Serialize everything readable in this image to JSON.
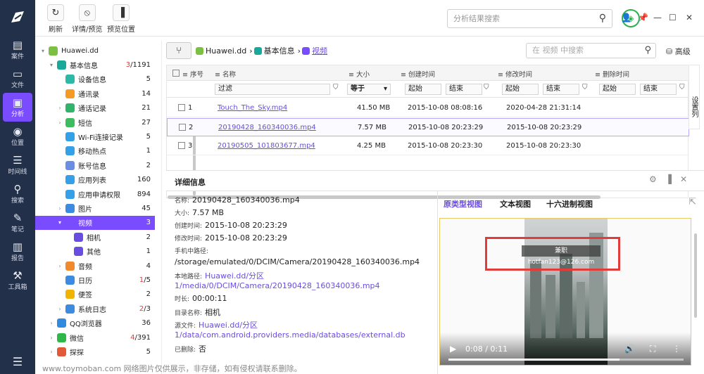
{
  "rail": [
    {
      "label": "案件",
      "icon": "case-icon"
    },
    {
      "label": "文件",
      "icon": "folder-icon"
    },
    {
      "label": "分析",
      "icon": "analysis-icon",
      "active": true
    },
    {
      "label": "位置",
      "icon": "location-icon"
    },
    {
      "label": "时间线",
      "icon": "timeline-icon"
    },
    {
      "label": "搜索",
      "icon": "search-icon"
    },
    {
      "label": "笔记",
      "icon": "note-icon"
    },
    {
      "label": "报告",
      "icon": "report-icon"
    },
    {
      "label": "工具箱",
      "icon": "toolbox-icon"
    }
  ],
  "toolbar": {
    "refresh": "刷新",
    "details": "详情/预览",
    "preview_pos": "预览位置",
    "global_search_placeholder": "分析结果搜索"
  },
  "tree": [
    {
      "label": "Huawei.dd",
      "indent": 0,
      "arrow": "▾",
      "color": "#7bc043"
    },
    {
      "label": "基本信息",
      "indent": 1,
      "arrow": "▾",
      "color": "#18a99b",
      "cnt_red": "3",
      "cnt": "/1191"
    },
    {
      "label": "设备信息",
      "indent": 2,
      "color": "#2db7a6",
      "cnt": "5"
    },
    {
      "label": "通讯录",
      "indent": 2,
      "color": "#f59a23",
      "cnt": "14"
    },
    {
      "label": "通话记录",
      "indent": 2,
      "arrow": "›",
      "color": "#31b36b",
      "cnt": "21"
    },
    {
      "label": "短信",
      "indent": 2,
      "arrow": "›",
      "color": "#3dbb5e",
      "cnt": "27"
    },
    {
      "label": "Wi-Fi连接记录",
      "indent": 2,
      "color": "#33a0e8",
      "cnt": "5"
    },
    {
      "label": "移动热点",
      "indent": 2,
      "color": "#33a0e8",
      "cnt": "1"
    },
    {
      "label": "账号信息",
      "indent": 2,
      "color": "#6a8de6",
      "cnt": "2"
    },
    {
      "label": "应用列表",
      "indent": 2,
      "color": "#33a0e8",
      "cnt": "160"
    },
    {
      "label": "应用申请权限",
      "indent": 2,
      "color": "#33a0e8",
      "cnt": "894"
    },
    {
      "label": "图片",
      "indent": 2,
      "arrow": "›",
      "color": "#3c8be0",
      "cnt": "45"
    },
    {
      "label": "视频",
      "indent": 2,
      "arrow": "▾",
      "color": "#7a4cff",
      "cnt": "3",
      "active": true
    },
    {
      "label": "相机",
      "indent": 3,
      "color": "#6a4de0",
      "cnt": "2"
    },
    {
      "label": "其他",
      "indent": 3,
      "color": "#6a4de0",
      "cnt": "1"
    },
    {
      "label": "音频",
      "indent": 2,
      "arrow": "›",
      "color": "#f08a2c",
      "cnt": "4"
    },
    {
      "label": "日历",
      "indent": 2,
      "color": "#3c8be0",
      "cnt_red": "1",
      "cnt": "/5"
    },
    {
      "label": "便签",
      "indent": 2,
      "color": "#f0b400",
      "cnt": "2"
    },
    {
      "label": "系统日志",
      "indent": 2,
      "arrow": "›",
      "color": "#3c8be0",
      "cnt_red": "2",
      "cnt": "/3"
    },
    {
      "label": "QQ浏览器",
      "indent": 1,
      "arrow": "›",
      "color": "#2f8ae0",
      "cnt": "36"
    },
    {
      "label": "微信",
      "indent": 1,
      "arrow": "›",
      "color": "#2fb84a",
      "cnt_red": "4",
      "cnt": "/391"
    },
    {
      "label": "探探",
      "indent": 1,
      "arrow": "›",
      "color": "#e2593a",
      "cnt": "5"
    }
  ],
  "crumbs": {
    "root": "Huawei.dd",
    "sep": "›",
    "basic": "基本信息",
    "video": "视频",
    "search_placeholder": "在 视频 中搜索",
    "advanced": "高级"
  },
  "columns": {
    "seq": "序号",
    "name": "名称",
    "size": "大小",
    "created": "创建时间",
    "modified": "修改时间",
    "deleted": "删除时间",
    "settings": "设置列"
  },
  "filters": {
    "name": "过滤",
    "size_op": "等于",
    "start": "起始",
    "end": "结束"
  },
  "rows": [
    {
      "idx": "1",
      "name": "Touch_The_Sky.mp4",
      "size": "41.50 MB",
      "created": "2015-10-08 08:08:16",
      "modified": "2020-04-28 21:31:14"
    },
    {
      "idx": "2",
      "name": "20190428_160340036.mp4",
      "size": "7.57 MB",
      "created": "2015-10-08 20:23:29",
      "modified": "2015-10-08 20:23:29"
    },
    {
      "idx": "3",
      "name": "20190505_101803677.mp4",
      "size": "4.25 MB",
      "created": "2015-10-08 20:23:30",
      "modified": "2015-10-08 20:23:30"
    }
  ],
  "detail": {
    "title": "详细信息",
    "name_k": "名称:",
    "name_v": "20190428_160340036.mp4",
    "size_k": "大小:",
    "size_v": "7.57 MB",
    "created_k": "创建时间:",
    "created_v": "2015-10-08 20:23:29",
    "modified_k": "修改时间:",
    "modified_v": "2015-10-08 20:23:29",
    "phone_path_k": "手机中路径:",
    "phone_path_v": "/storage/emulated/0/DCIM/Camera/20190428_160340036.mp4",
    "local_path_k": "本地路径:",
    "local_path_v1": "Huawei.dd/分区",
    "local_path_v2": "1/media/0/DCIM/Camera/20190428_160340036.mp4",
    "duration_k": "时长:",
    "duration_v": "00:00:11",
    "dir_k": "目录名称:",
    "dir_v": "相机",
    "source_k": "源文件:",
    "source_v1": "Huawei.dd/分区",
    "source_v2": "1/data/com.android.providers.media/databases/external.db",
    "deleted_k": "已删除:",
    "deleted_v": "否"
  },
  "views": {
    "tab1": "原类型视图",
    "tab2": "文本视图",
    "tab3": "十六进制视图",
    "watermark": "兼职hotfan123@126.com",
    "time": "0:08 / 0:11",
    "progress": 0.727
  },
  "footer": {
    "text": "www.toymoban.com 网络图片仅供展示，非存储，如有侵权请联系删除。"
  }
}
